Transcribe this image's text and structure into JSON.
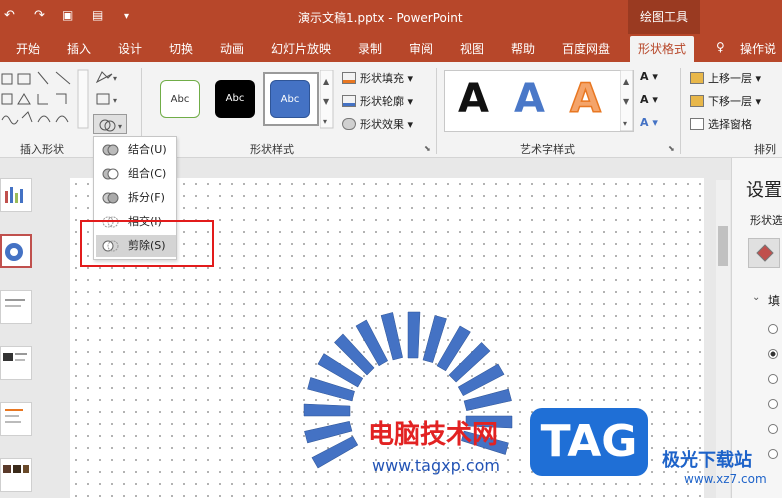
{
  "titlebar": {
    "title": "演示文稿1.pptx  -  PowerPoint",
    "context_tab": "绘图工具",
    "undo_icon": "undo-icon",
    "redo_icon": "redo-icon"
  },
  "tabs": [
    {
      "label": "开始"
    },
    {
      "label": "插入"
    },
    {
      "label": "设计"
    },
    {
      "label": "切换"
    },
    {
      "label": "动画"
    },
    {
      "label": "幻灯片放映"
    },
    {
      "label": "录制"
    },
    {
      "label": "审阅"
    },
    {
      "label": "视图"
    },
    {
      "label": "帮助"
    },
    {
      "label": "百度网盘"
    },
    {
      "label": "形状格式"
    },
    {
      "label": "操作说"
    }
  ],
  "ribbon": {
    "groups": {
      "insert_shapes": "插入形状",
      "shape_styles": "形状样式",
      "art_styles": "艺术字样式",
      "arrange": "排列"
    },
    "style_swatch_label": "Abc",
    "shape_fill": "形状填充",
    "shape_outline": "形状轮廓",
    "shape_effect": "形状效果",
    "art_letter": "A",
    "bring_forward": "上移一层",
    "send_backward": "下移一层",
    "selection_pane": "选择窗格"
  },
  "merge_menu": {
    "items": [
      {
        "label": "结合(U)"
      },
      {
        "label": "组合(C)"
      },
      {
        "label": "拆分(F)"
      },
      {
        "label": "相交(I)"
      },
      {
        "label": "剪除(S)"
      }
    ],
    "highlighted_index": 4
  },
  "right_pane": {
    "title": "设置",
    "subtitle": "形状选",
    "section": "填"
  },
  "watermark": {
    "cn_text": "电脑技术网",
    "url": "www.tagxp.com",
    "tag": "TAG",
    "site_name": "极光下载站",
    "site_url": "www.xz7.com"
  },
  "colors": {
    "accent": "#b7472a",
    "shape_blue": "#4472c4",
    "highlight_red": "#e21b1b"
  }
}
